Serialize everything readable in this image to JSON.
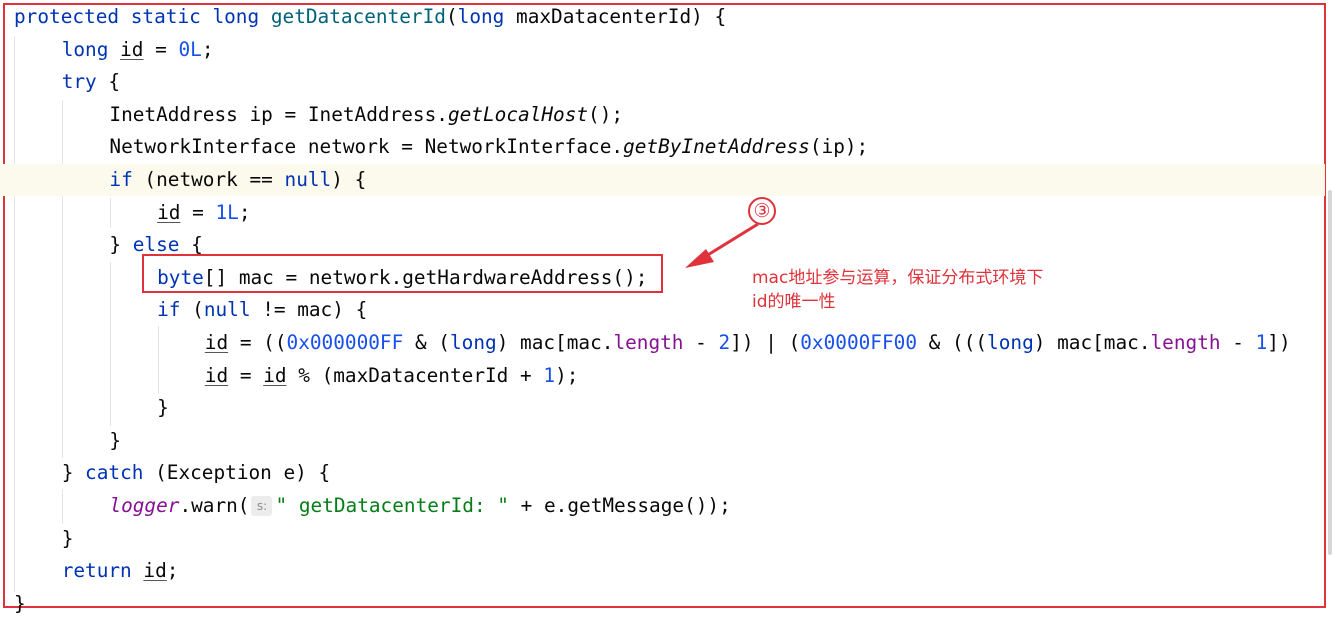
{
  "code_lines": [
    {
      "indent": 0,
      "tokens": [
        [
          "protected static long ",
          "kw"
        ],
        [
          "getDatacenterId",
          "fn"
        ],
        [
          "(",
          ""
        ],
        [
          "long ",
          "kw"
        ],
        [
          "maxDatacenterId) {",
          ""
        ]
      ]
    },
    {
      "indent": 1,
      "tokens": [
        [
          "long ",
          "kw"
        ],
        [
          "id",
          "ul"
        ],
        [
          " = ",
          ""
        ],
        [
          "0L",
          "num"
        ],
        [
          ";",
          ""
        ]
      ]
    },
    {
      "indent": 1,
      "tokens": [
        [
          "try ",
          "kw"
        ],
        [
          "{",
          ""
        ]
      ]
    },
    {
      "indent": 2,
      "tokens": [
        [
          "InetAddress ip = InetAddress.",
          ""
        ],
        [
          "getLocalHost",
          "it"
        ],
        [
          "();",
          ""
        ]
      ]
    },
    {
      "indent": 2,
      "tokens": [
        [
          "NetworkInterface network = NetworkInterface.",
          ""
        ],
        [
          "getByInetAddress",
          "it"
        ],
        [
          "(ip);",
          ""
        ]
      ]
    },
    {
      "indent": 2,
      "highlight": true,
      "tokens": [
        [
          "if ",
          "kw"
        ],
        [
          "(network == ",
          ""
        ],
        [
          "null",
          "kw"
        ],
        [
          ") {",
          ""
        ]
      ]
    },
    {
      "indent": 3,
      "tokens": [
        [
          "id",
          "ul"
        ],
        [
          " = ",
          ""
        ],
        [
          "1L",
          "num"
        ],
        [
          ";",
          ""
        ]
      ]
    },
    {
      "indent": 2,
      "tokens": [
        [
          "} ",
          ""
        ],
        [
          "else ",
          "kw"
        ],
        [
          "{",
          ""
        ]
      ]
    },
    {
      "indent": 3,
      "tokens": [
        [
          "byte",
          "kw"
        ],
        [
          "[] mac = network.getHardwareAddress();",
          ""
        ]
      ]
    },
    {
      "indent": 3,
      "tokens": [
        [
          "if ",
          "kw"
        ],
        [
          "(",
          ""
        ],
        [
          "null ",
          "kw"
        ],
        [
          "!= mac) {",
          ""
        ]
      ]
    },
    {
      "indent": 4,
      "tokens": [
        [
          "id",
          "ul"
        ],
        [
          " = ((",
          ""
        ],
        [
          "0x000000FF",
          "num"
        ],
        [
          " & (",
          ""
        ],
        [
          "long",
          "kw"
        ],
        [
          ") mac[mac.",
          ""
        ],
        [
          "length",
          "field"
        ],
        [
          " - ",
          ""
        ],
        [
          "2",
          "num"
        ],
        [
          "]) | (",
          ""
        ],
        [
          "0x0000FF00",
          "num"
        ],
        [
          " & (((",
          ""
        ],
        [
          "long",
          "kw"
        ],
        [
          ") mac[mac.",
          ""
        ],
        [
          "length",
          "field"
        ],
        [
          " - ",
          ""
        ],
        [
          "1",
          "num"
        ],
        [
          "])",
          ""
        ]
      ]
    },
    {
      "indent": 4,
      "tokens": [
        [
          "id",
          "ul"
        ],
        [
          " = ",
          ""
        ],
        [
          "id",
          "ul"
        ],
        [
          " % (maxDatacenterId + ",
          ""
        ],
        [
          "1",
          "num"
        ],
        [
          ");",
          ""
        ]
      ]
    },
    {
      "indent": 3,
      "tokens": [
        [
          "}",
          ""
        ]
      ]
    },
    {
      "indent": 2,
      "tokens": [
        [
          "}",
          ""
        ]
      ]
    },
    {
      "indent": 1,
      "tokens": [
        [
          "} ",
          ""
        ],
        [
          "catch ",
          "kw"
        ],
        [
          "(Exception e) {",
          ""
        ]
      ]
    },
    {
      "indent": 2,
      "tokens": [
        [
          "logger",
          "field it"
        ],
        [
          ".warn(",
          ""
        ],
        [
          "s:",
          "hint"
        ],
        [
          "\" getDatacenterId: \"",
          "str"
        ],
        [
          " + e.getMessage());",
          ""
        ]
      ]
    },
    {
      "indent": 1,
      "tokens": [
        [
          "}",
          ""
        ]
      ]
    },
    {
      "indent": 1,
      "tokens": [
        [
          "return ",
          "kw"
        ],
        [
          "id",
          "ul"
        ],
        [
          ";",
          ""
        ]
      ]
    },
    {
      "indent": 0,
      "tokens": [
        [
          "}",
          ""
        ]
      ]
    }
  ],
  "annotation": {
    "marker": "③",
    "note_line1": "mac地址参与运算，保证分布式环境下",
    "note_line2": "id的唯一性"
  },
  "colors": {
    "annotation_red": "#e0323a",
    "keyword": "#0033b3",
    "number": "#1750eb",
    "method_decl": "#00627a",
    "field": "#871094",
    "string": "#067d17",
    "current_line_bg": "#fcfaed"
  }
}
